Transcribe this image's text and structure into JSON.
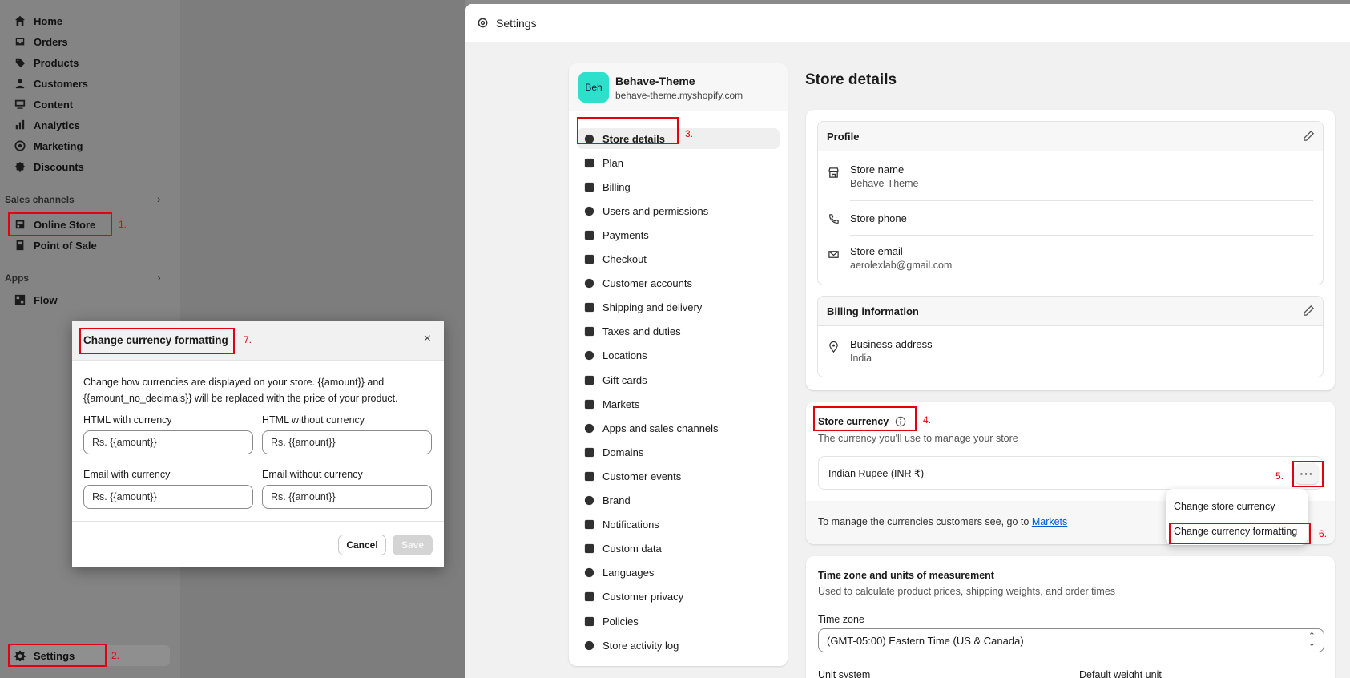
{
  "sidebar": {
    "items": [
      {
        "label": "Home",
        "icon": "home-icon"
      },
      {
        "label": "Orders",
        "icon": "inbox-icon"
      },
      {
        "label": "Products",
        "icon": "tag-icon"
      },
      {
        "label": "Customers",
        "icon": "person-icon"
      },
      {
        "label": "Content",
        "icon": "image-icon"
      },
      {
        "label": "Analytics",
        "icon": "bar-chart-icon"
      },
      {
        "label": "Marketing",
        "icon": "target-icon"
      },
      {
        "label": "Discounts",
        "icon": "discount-icon"
      }
    ],
    "sales_channels_label": "Sales channels",
    "sales_channels": [
      {
        "label": "Online Store",
        "icon": "store-icon"
      },
      {
        "label": "Point of Sale",
        "icon": "pos-icon"
      }
    ],
    "apps_label": "Apps",
    "apps": [
      {
        "label": "Flow",
        "icon": "flow-icon"
      }
    ],
    "settings_label": "Settings"
  },
  "steps": {
    "s1": "1.",
    "s2": "2.",
    "s3": "3.",
    "s4": "4.",
    "s5": "5.",
    "s6": "6.",
    "s7": "7."
  },
  "window": {
    "title": "Settings"
  },
  "store": {
    "avatar": "Beh",
    "name": "Behave-Theme",
    "domain": "behave-theme.myshopify.com"
  },
  "settings_nav": [
    "Store details",
    "Plan",
    "Billing",
    "Users and permissions",
    "Payments",
    "Checkout",
    "Customer accounts",
    "Shipping and delivery",
    "Taxes and duties",
    "Locations",
    "Gift cards",
    "Markets",
    "Apps and sales channels",
    "Domains",
    "Customer events",
    "Brand",
    "Notifications",
    "Custom data",
    "Languages",
    "Customer privacy",
    "Policies",
    "Store activity log"
  ],
  "main": {
    "title": "Store details",
    "profile": {
      "heading": "Profile",
      "store_name_label": "Store name",
      "store_name": "Behave-Theme",
      "phone_label": "Store phone",
      "email_label": "Store email",
      "email": "aerolexlab@gmail.com"
    },
    "billing": {
      "heading": "Billing information",
      "address_label": "Business address",
      "address": "India"
    },
    "currency": {
      "heading": "Store currency",
      "subtitle": "The currency you'll use to manage your store",
      "value": "Indian Rupee (INR ₹)",
      "more": "···",
      "manage_text": "To manage the currencies customers see, go to",
      "manage_link": "Markets",
      "menu": [
        "Change store currency",
        "Change currency formatting"
      ]
    },
    "timezone": {
      "heading": "Time zone and units of measurement",
      "subtitle": "Used to calculate product prices, shipping weights, and order times",
      "tz_label": "Time zone",
      "tz_value": "(GMT-05:00) Eastern Time (US & Canada)",
      "unit_label": "Unit system",
      "weight_label": "Default weight unit"
    }
  },
  "modal": {
    "title": "Change currency formatting",
    "close": "×",
    "description": "Change how currencies are displayed on your store. {{amount}} and {{amount_no_decimals}} will be replaced with the price of your product.",
    "html_with_label": "HTML with currency",
    "html_with_value": "Rs. {{amount}}",
    "html_without_label": "HTML without currency",
    "html_without_value": "Rs. {{amount}}",
    "email_with_label": "Email with currency",
    "email_with_value": "Rs. {{amount}}",
    "email_without_label": "Email without currency",
    "email_without_value": "Rs. {{amount}}",
    "cancel": "Cancel",
    "save": "Save"
  },
  "colors": {
    "accent_teal": "#2ce0cb",
    "annotation_red": "#e3000f",
    "link_blue": "#005bd3"
  }
}
